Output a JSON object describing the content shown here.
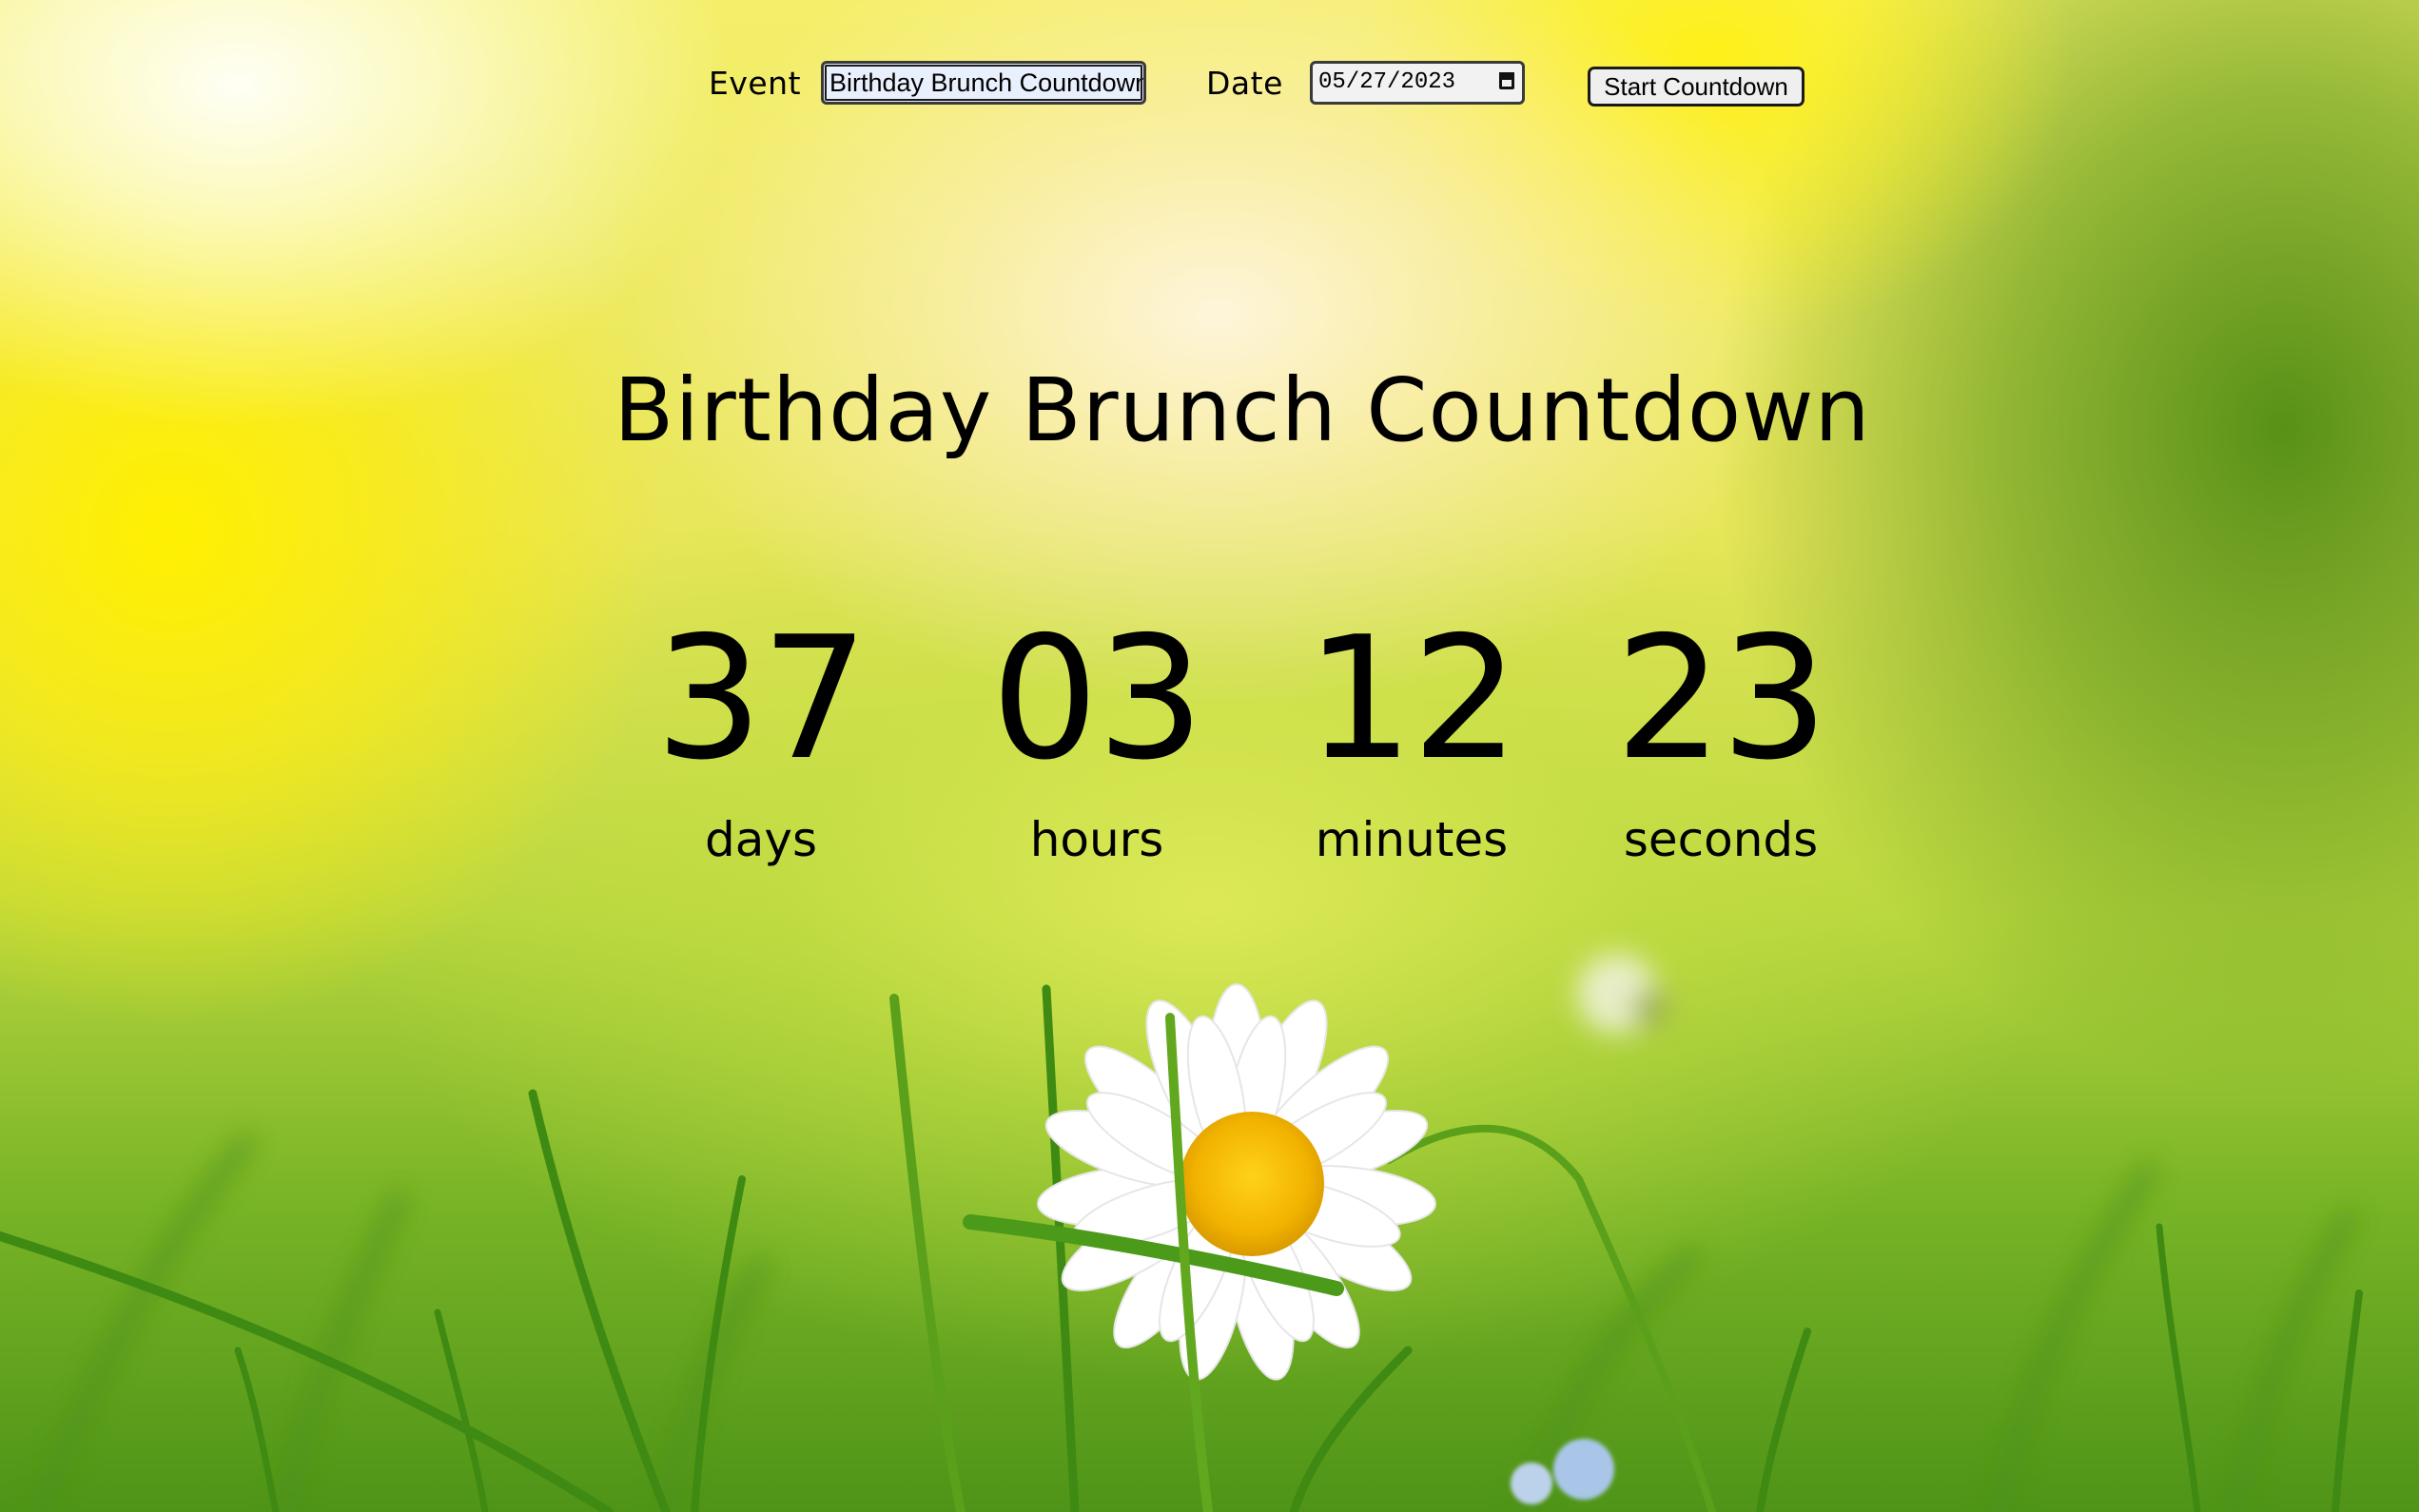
{
  "form": {
    "event_label": "Event",
    "event_value": "Birthday Brunch Countdowr",
    "date_label": "Date",
    "date_value": "05/27/2023",
    "start_button": "Start Countdown"
  },
  "countdown": {
    "title": "Birthday Brunch Countdown",
    "units": [
      {
        "value": "37",
        "label": "days"
      },
      {
        "value": "03",
        "label": "hours"
      },
      {
        "value": "12",
        "label": "minutes"
      },
      {
        "value": "23",
        "label": "seconds"
      }
    ]
  },
  "background": {
    "description_colors": {
      "yellow": "#f5ec1e",
      "green": "#5a9c1c",
      "petal": "#ffffff",
      "center": "#f2b705"
    }
  }
}
